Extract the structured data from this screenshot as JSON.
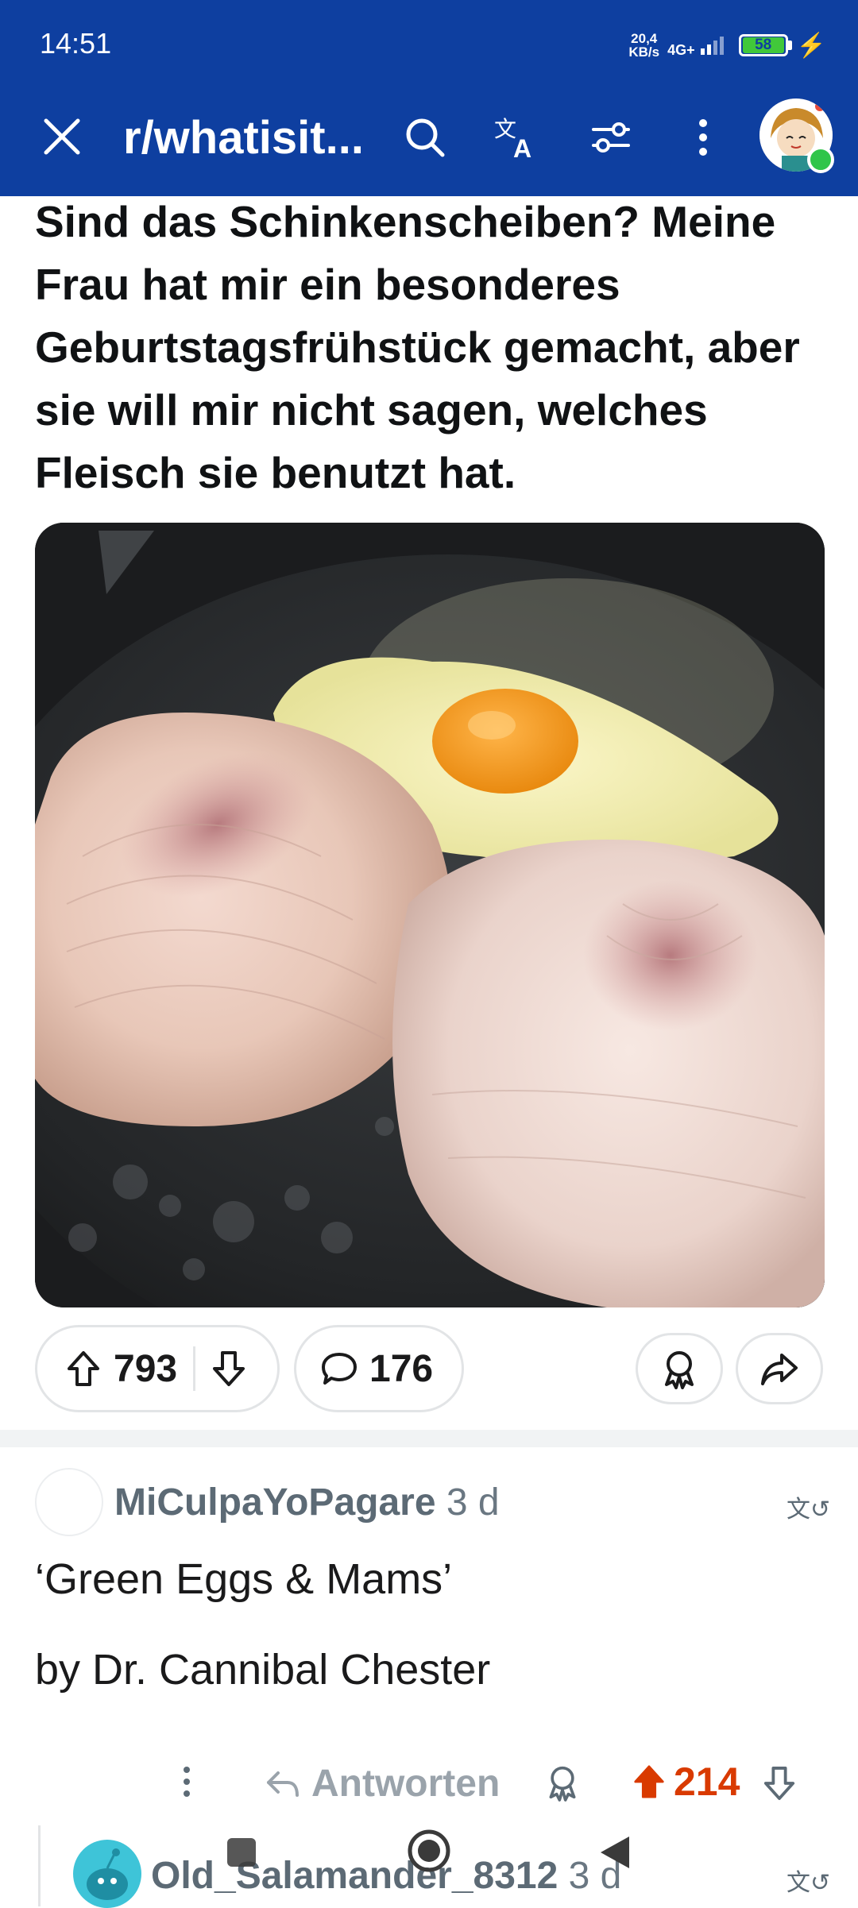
{
  "status": {
    "time": "14:51",
    "net_speed_value": "20,4",
    "net_speed_unit": "KB/s",
    "network": "4G+",
    "battery": "58"
  },
  "appbar": {
    "subreddit": "r/whatisit...",
    "icons": [
      "close-icon",
      "search-icon",
      "translate-icon",
      "filter-icon",
      "more-vertical-icon",
      "avatar"
    ]
  },
  "post": {
    "title": "Sind das Schinkenscheiben? Meine Frau hat mir ein besonderes Geburtstagsfrühstück gemacht, aber sie will mir nicht sagen, welches Fleisch sie benutzt hat.",
    "votes": "793",
    "comments": "176"
  },
  "comment": {
    "author": "MiCulpaYoPagare",
    "time": "3 d",
    "line1": "‘Green Eggs & Mams’",
    "line2": "by Dr. Cannibal Chester",
    "reply_label": "Antworten",
    "score": "214"
  },
  "reply": {
    "author": "Old_Salamander_8312",
    "time": "3 d"
  },
  "colors": {
    "header": "#0e3fa0",
    "upvote": "#d93a00",
    "muted": "#5c6a75"
  }
}
